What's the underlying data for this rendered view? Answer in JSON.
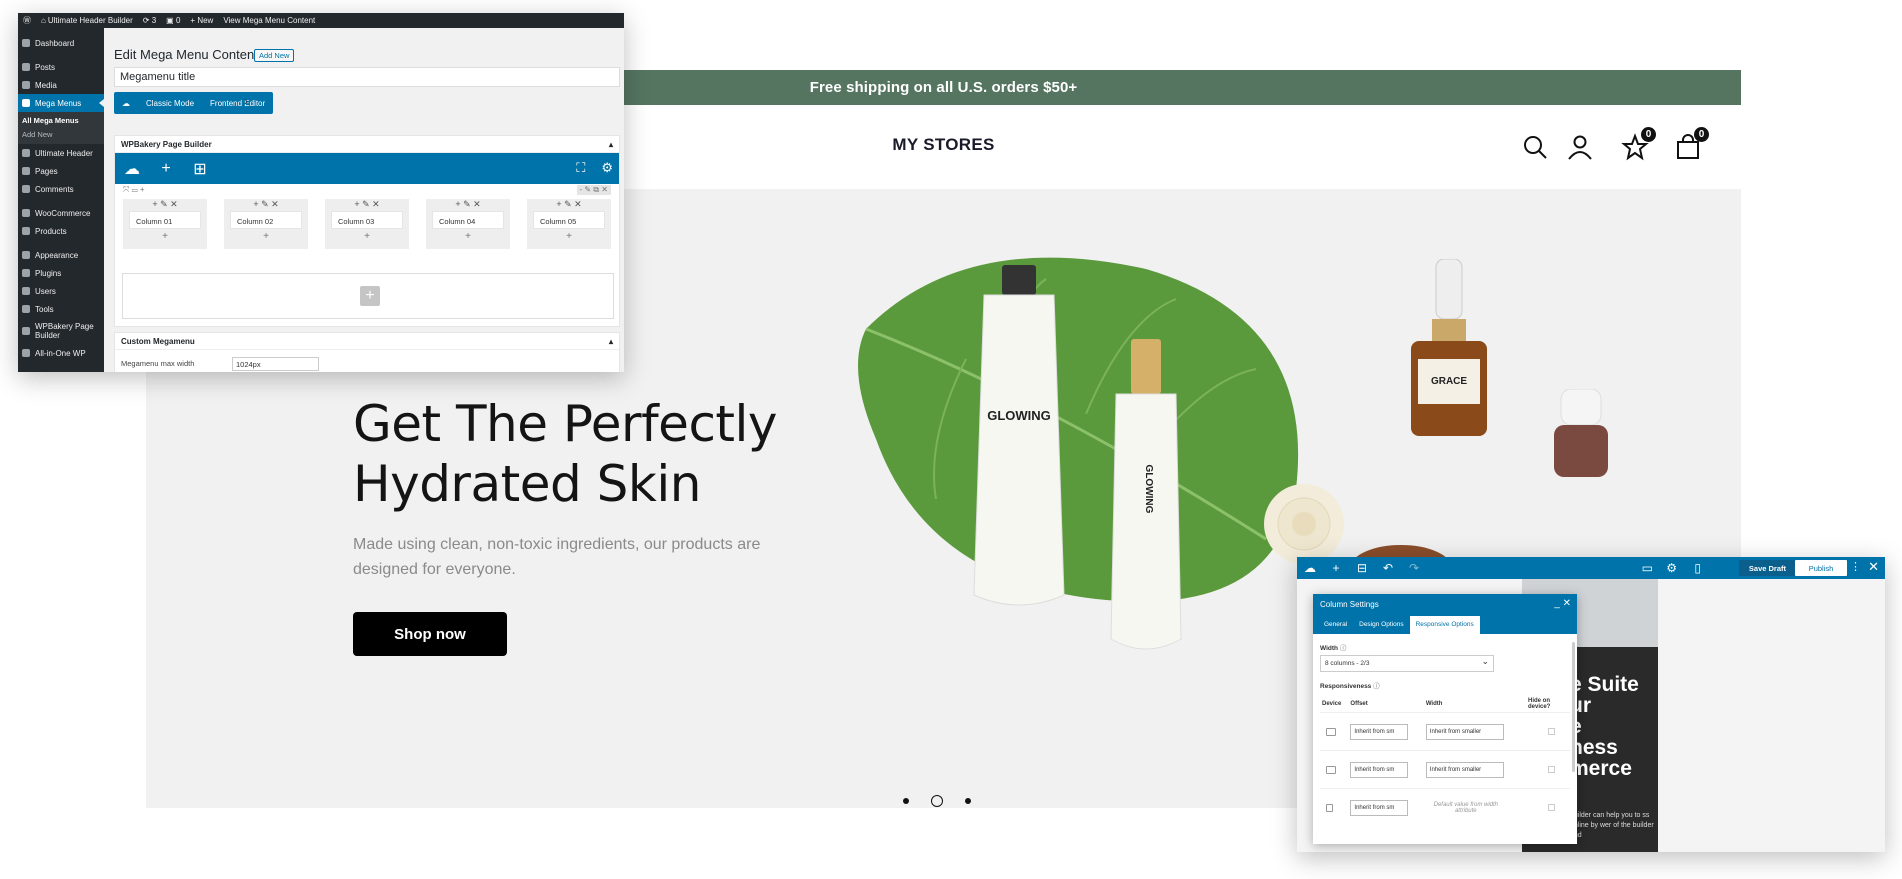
{
  "store": {
    "announcement": "Free shipping on all U.S. orders $50+",
    "brand": "MY STORES",
    "wishlist_count": "0",
    "cart_count": "0",
    "hero": {
      "title_line1": "Get The Perfectly",
      "title_line2": "Hydrated Skin",
      "subtitle": "Made using clean, non-toxic ingredients, our products are designed for everyone.",
      "cta": "Shop now",
      "product1": "GLOWING",
      "product2": "GLOWING",
      "product3": "GRACE"
    }
  },
  "wp": {
    "adminbar": {
      "site": "Ultimate Header Builder",
      "updates": "3",
      "comments": "0",
      "new": "New",
      "view": "View Mega Menu Content"
    },
    "sidebar": {
      "items": [
        {
          "label": "Dashboard"
        },
        {
          "label": "Posts"
        },
        {
          "label": "Media"
        },
        {
          "label": "Mega Menus"
        },
        {
          "label": "Ultimate Header"
        },
        {
          "label": "Pages"
        },
        {
          "label": "Comments"
        },
        {
          "label": "WooCommerce"
        },
        {
          "label": "Products"
        },
        {
          "label": "Appearance"
        },
        {
          "label": "Plugins"
        },
        {
          "label": "Users"
        },
        {
          "label": "Tools"
        },
        {
          "label": "WPBakery Page Builder"
        },
        {
          "label": "All-in-One WP"
        }
      ],
      "submenu": [
        "All Mega Menus",
        "Add New"
      ]
    },
    "page_title": "Edit Mega Menu Content",
    "add_new": "Add New",
    "title_value": "Megamenu title",
    "mode_classic": "Classic Mode",
    "mode_frontend": "Frontend Editor",
    "builder_title": "WPBakery Page Builder",
    "columns": [
      "Column 01",
      "Column 02",
      "Column 03",
      "Column 04",
      "Column 05"
    ],
    "custom_title": "Custom Megamenu",
    "max_width_label": "Megamenu max width",
    "max_width_value": "1024px"
  },
  "fe": {
    "save_draft": "Save Draft",
    "publish": "Publish",
    "panel_title": "Column Settings",
    "tabs": [
      "General",
      "Design Options",
      "Responsive Options"
    ],
    "width_label": "Width",
    "width_value": "8 columns - 2/3",
    "responsiveness_label": "Responsiveness",
    "col_device": "Device",
    "col_offset": "Offset",
    "col_width": "Width",
    "col_hide": "Hide on device?",
    "offset_value": "Inherit from sm",
    "width_inherit": "Inherit from smaller",
    "default_width": "Default value from width attribute",
    "bg_text": "e Suite\nur\ne\nness\nmerce",
    "bg_small": "builder can help you to ss online by wer of the builder and"
  }
}
